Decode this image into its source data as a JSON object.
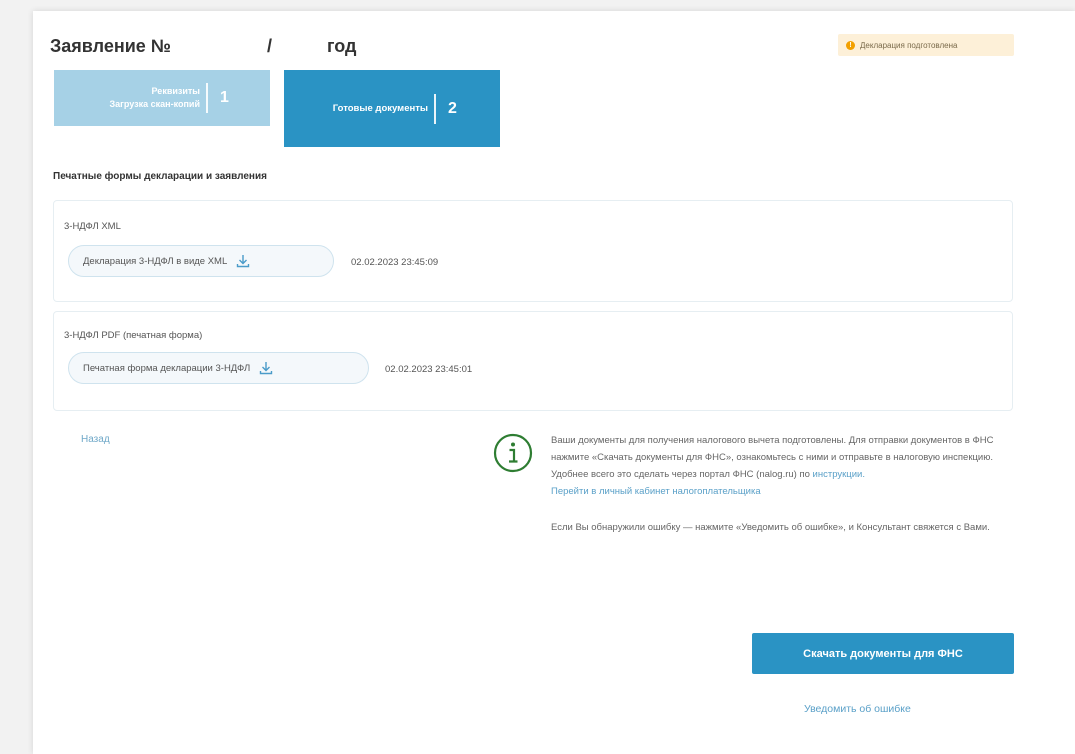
{
  "header": {
    "title_prefix": "Заявление №",
    "title_slash": "/",
    "title_suffix": "год",
    "status_icon_glyph": "!",
    "status_badge": "Декларация подготовлена",
    "status_color": "#f2a000"
  },
  "steps": [
    {
      "label_line1": "Реквизиты",
      "label_line2": "Загрузка скан-копий",
      "number": "1",
      "color": "#a6d1e6"
    },
    {
      "label": "Готовые документы",
      "number": "2",
      "color": "#2a93c4"
    }
  ],
  "section_title": "Печатные формы декларации и заявления",
  "documents": [
    {
      "type": "3-НДФЛ XML",
      "file_label": "Декларация 3-НДФЛ в виде XML",
      "icon": "download-icon",
      "date": "02.02.2023 23:45:09"
    },
    {
      "type": "3-НДФЛ PDF (печатная форма)",
      "file_label": "Печатная форма декларации 3-НДФЛ",
      "icon": "download-icon",
      "date": "02.02.2023 23:45:01"
    }
  ],
  "back_link": "Назад",
  "info": {
    "icon": "info-icon",
    "paragraph1_text": "Ваши документы для получения налогового вычета подготовлены. Для отправки документов в ФНС нажмите «Скачать документы для ФНС», ознакомьтесь с ними и отправьте в налоговую инспекцию. Удобнее всего это сделать через портал ФНС (nalog.ru) по ",
    "paragraph1_link1": "инструкции.",
    "paragraph1_link2": "Перейти в личный кабинет налогоплательщика",
    "paragraph2": "Если Вы обнаружили ошибку — нажмите «Уведомить об ошибке», и Консультант свяжется с Вами."
  },
  "actions": {
    "download_button": "Скачать документы для ФНС",
    "report_error": "Уведомить об ошибке"
  },
  "colors": {
    "accent": "#2a93c4",
    "accent_light": "#a6d1e6",
    "link": "#5aa0c8",
    "badge_bg": "#fdf0d8"
  }
}
